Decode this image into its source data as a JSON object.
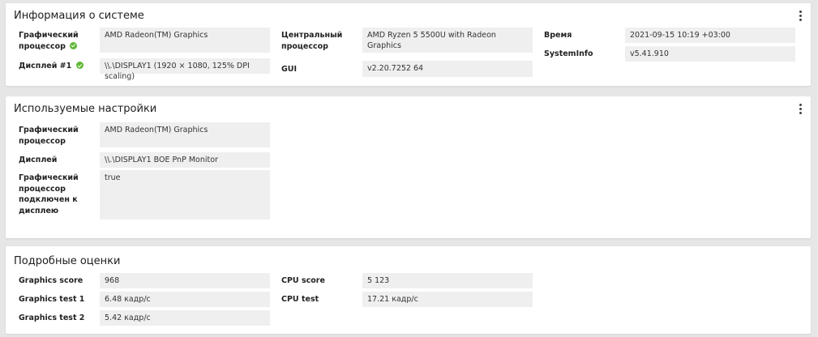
{
  "system_info": {
    "title": "Информация о системе",
    "gpu_label": "Графический процессор",
    "gpu_value": "AMD Radeon(TM) Graphics",
    "display_label": "Дисплей #1",
    "display_value": "\\\\.\\DISPLAY1 (1920 × 1080, 125% DPI scaling)",
    "cpu_label": "Центральный процессор",
    "cpu_value": "AMD Ryzen 5 5500U with Radeon Graphics",
    "gui_label": "GUI",
    "gui_value": "v2.20.7252 64",
    "time_label": "Время",
    "time_value": "2021-09-15 10:19 +03:00",
    "sysinfo_label": "SystemInfo",
    "sysinfo_value": "v5.41.910"
  },
  "used_settings": {
    "title": "Используемые настройки",
    "gpu_label": "Графический процессор",
    "gpu_value": "AMD Radeon(TM) Graphics",
    "display_label": "Дисплей",
    "display_value": "\\\\.\\DISPLAY1 BOE PnP Monitor",
    "connected_label": "Графический процессор подключен к дисплею",
    "connected_value": "true"
  },
  "detailed_scores": {
    "title": "Подробные оценки",
    "graphics_score_label": "Graphics score",
    "graphics_score_value": "968",
    "graphics_test1_label": "Graphics test 1",
    "graphics_test1_value": "6.48 кадр/с",
    "graphics_test2_label": "Graphics test 2",
    "graphics_test2_value": "5.42 кадр/с",
    "cpu_score_label": "CPU score",
    "cpu_score_value": "5 123",
    "cpu_test_label": "CPU test",
    "cpu_test_value": "17.21 кадр/с"
  },
  "colors": {
    "ok_status": "#5fb836",
    "value_bg": "#efefef",
    "page_bg": "#e6e6e6"
  },
  "icons": {
    "status": "check-circle-icon",
    "menu": "more-vert-icon"
  }
}
